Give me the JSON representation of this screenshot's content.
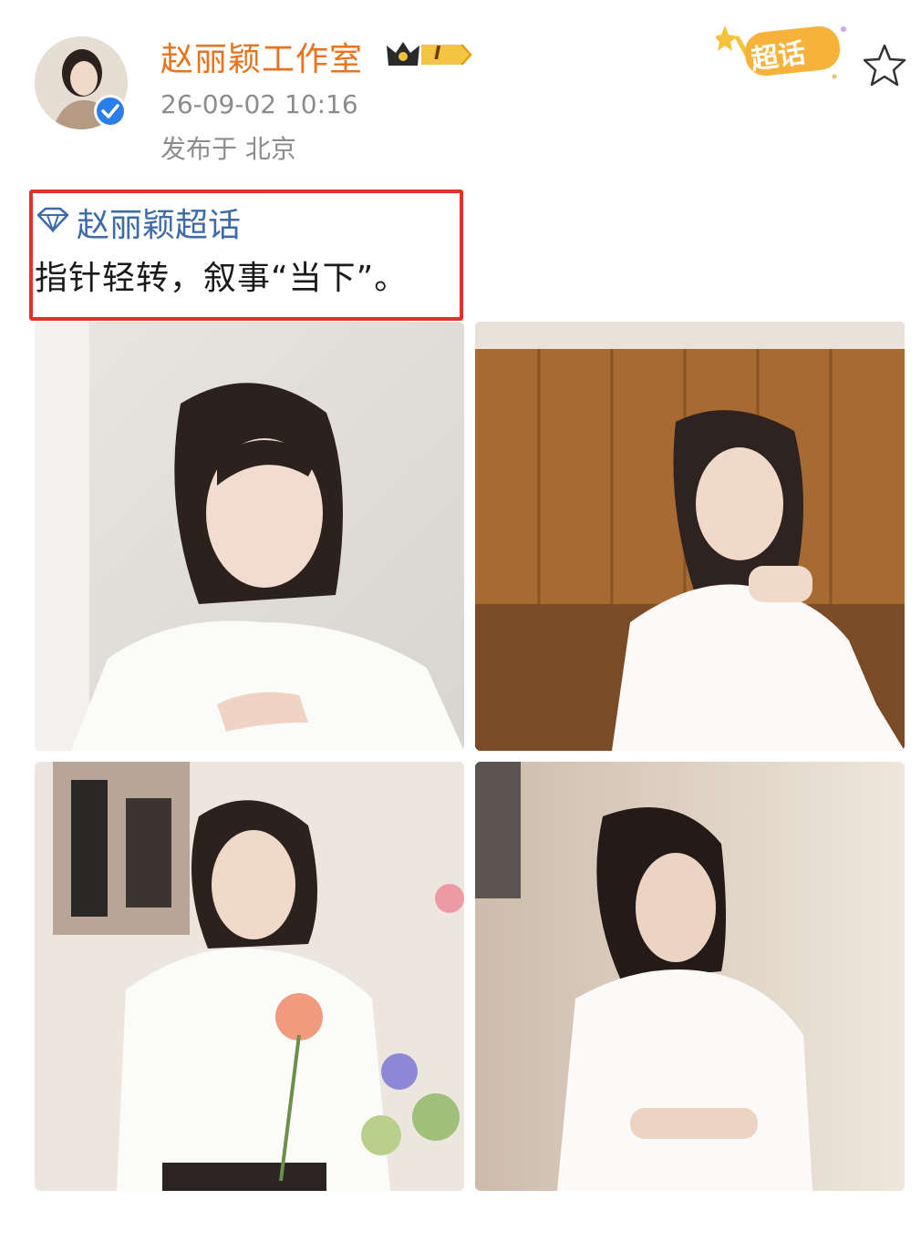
{
  "post": {
    "author": {
      "name": "赵丽颖工作室",
      "level": "I",
      "avatar_icon": "avatar-portrait",
      "verified_icon": "verified-check-icon",
      "crown_icon": "crown-icon"
    },
    "timestamp": "26-09-02 10:16",
    "location": "发布于 北京",
    "super_topic_badge": "超话",
    "favorite_icon": "star-outline-icon",
    "topic": {
      "icon": "diamond-icon",
      "label": "赵丽颖超话"
    },
    "text": "指针轻转，叙事“当下”。",
    "highlight_color": "#e0332a",
    "images": [
      {
        "name": "photo-1"
      },
      {
        "name": "photo-2"
      },
      {
        "name": "photo-3"
      },
      {
        "name": "photo-4"
      }
    ]
  },
  "colors": {
    "author_name": "#e8731d",
    "topic_link": "#3f6aa8",
    "meta_text": "#8c8c8c",
    "verified": "#2b7de9"
  }
}
